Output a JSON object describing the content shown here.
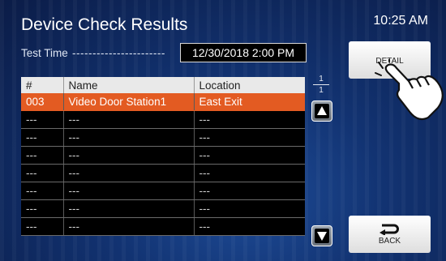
{
  "header": {
    "title": "Device Check Results",
    "time": "10:25 AM"
  },
  "test_time": {
    "label": "Test Time",
    "dashes": "-----------------------",
    "value": "12/30/2018  2:00 PM"
  },
  "table": {
    "columns": [
      "#",
      "Name",
      "Location"
    ],
    "rows": [
      [
        "003",
        "Video Door Station1",
        "East Exit"
      ],
      [
        "---",
        "---",
        "---"
      ],
      [
        "---",
        "---",
        "---"
      ],
      [
        "---",
        "---",
        "---"
      ],
      [
        "---",
        "---",
        "---"
      ],
      [
        "---",
        "---",
        "---"
      ],
      [
        "---",
        "---",
        "---"
      ],
      [
        "---",
        "---",
        "---"
      ]
    ],
    "selected_row": 0
  },
  "pagination": {
    "current": "1",
    "total": "1"
  },
  "buttons": {
    "detail": "DETAIL",
    "back": "BACK"
  },
  "icons": {
    "scroll_up": "triangle-up-icon",
    "scroll_down": "triangle-down-icon",
    "back": "return-arrow-icon",
    "pointer": "pointing-hand-icon"
  },
  "colors": {
    "selected_row": "#e35b22",
    "background": "#123372"
  }
}
